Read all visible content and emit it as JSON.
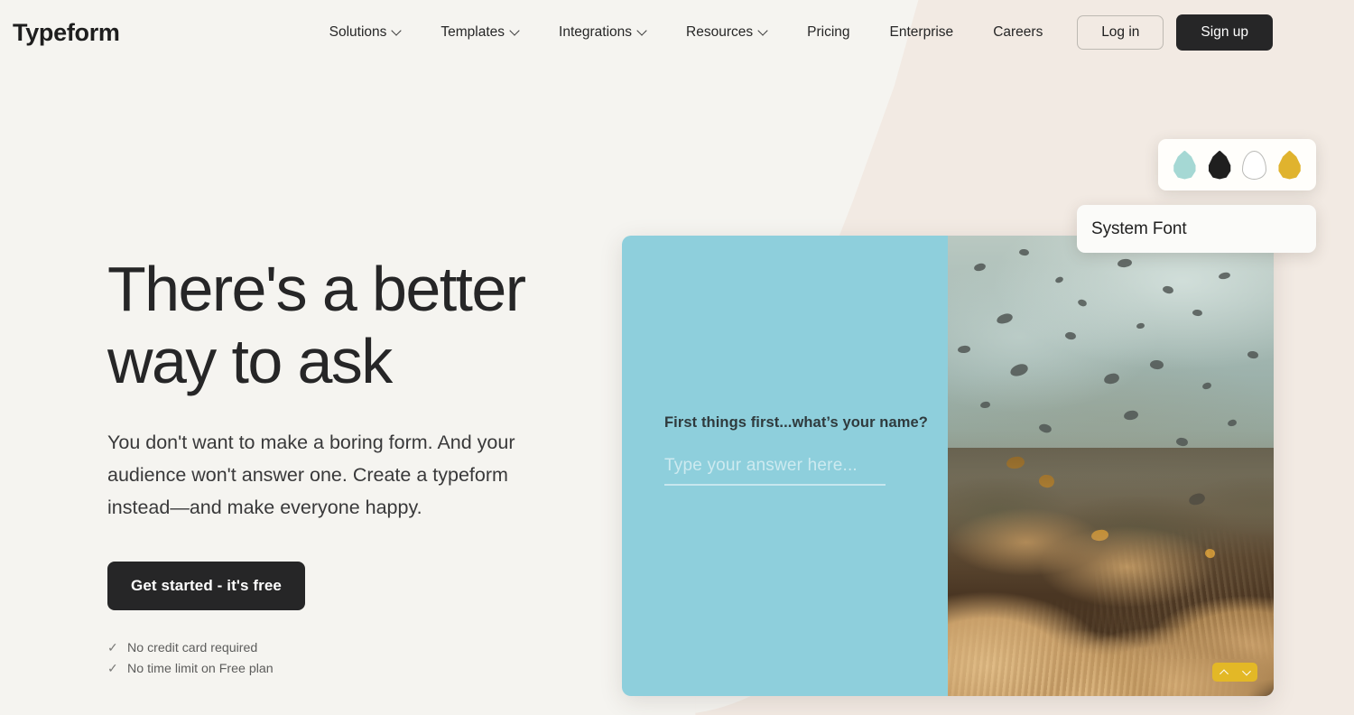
{
  "brand": {
    "logo": "Typeform",
    "accent_dark": "#262627",
    "accent_teal": "#8ecfdc",
    "accent_gold": "#e3b826",
    "bg_left": "#f5f4f0",
    "bg_right": "#f2eae3"
  },
  "header": {
    "nav": [
      {
        "label": "Solutions",
        "has_dropdown": true
      },
      {
        "label": "Templates",
        "has_dropdown": true
      },
      {
        "label": "Integrations",
        "has_dropdown": true
      },
      {
        "label": "Resources",
        "has_dropdown": true
      },
      {
        "label": "Pricing",
        "has_dropdown": false
      },
      {
        "label": "Enterprise",
        "has_dropdown": false
      },
      {
        "label": "Careers",
        "has_dropdown": false
      }
    ],
    "login_label": "Log in",
    "signup_label": "Sign up"
  },
  "hero": {
    "title_line1": "There's a better",
    "title_line2": "way to ask",
    "subtitle": "You don't want to make a boring form. And your audience won't answer one. Create a typeform instead—and make everyone happy.",
    "cta_label": "Get started - it's free",
    "perks": [
      {
        "check": "✓",
        "label": "No credit card required"
      },
      {
        "check": "✓",
        "label": "No time limit on Free plan"
      }
    ]
  },
  "product_mock": {
    "question": "First things first...what’s your name?",
    "answer_placeholder": "Type your answer here...",
    "nav_up_icon": "chevron-up-icon",
    "nav_down_icon": "chevron-down-icon"
  },
  "widgets": {
    "swatches": {
      "icon_name": "color-drop-icon",
      "colors": [
        {
          "name": "teal",
          "hex": "#a5d8d4"
        },
        {
          "name": "black",
          "hex": "#1f1f1f"
        },
        {
          "name": "white",
          "hex": "#ffffff"
        },
        {
          "name": "gold",
          "hex": "#e0b32e"
        }
      ]
    },
    "font_picker": {
      "value": "System Font"
    }
  }
}
